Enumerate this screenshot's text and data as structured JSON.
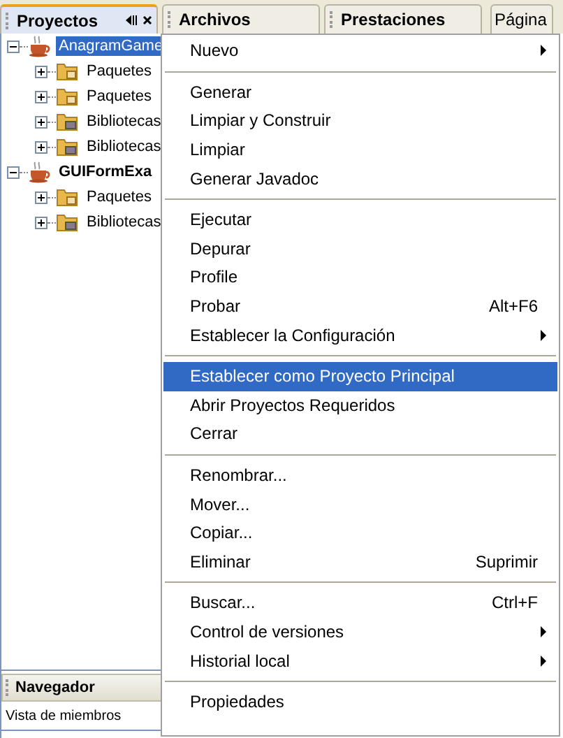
{
  "tabs": [
    {
      "label": "Proyectos",
      "selected": true,
      "closable": true
    },
    {
      "label": "Archivos",
      "selected": false,
      "closable": false
    },
    {
      "label": "Prestaciones",
      "selected": false,
      "closable": false
    },
    {
      "label": "Página",
      "selected": false,
      "closable": false,
      "kind": "editor"
    }
  ],
  "tree": [
    {
      "label": "AnagramGame",
      "kind": "project",
      "selected": true,
      "expanded": true,
      "children": [
        {
          "label": "Paquetes",
          "kind": "package",
          "expanded": false
        },
        {
          "label": "Paquetes",
          "kind": "package",
          "expanded": false
        },
        {
          "label": "Bibliotecas",
          "kind": "library",
          "expanded": false
        },
        {
          "label": "Bibliotecas",
          "kind": "library",
          "expanded": false
        }
      ]
    },
    {
      "label": "GUIFormExa",
      "kind": "project",
      "selected": false,
      "expanded": true,
      "children": [
        {
          "label": "Paquetes",
          "kind": "package",
          "expanded": false
        },
        {
          "label": "Bibliotecas",
          "kind": "library",
          "expanded": false
        }
      ]
    }
  ],
  "navigator": {
    "title": "Navegador",
    "view": "Vista de miembros"
  },
  "menu": [
    {
      "kind": "item",
      "label": "Nuevo",
      "submenu": true,
      "selected": false
    },
    {
      "kind": "separator"
    },
    {
      "kind": "item",
      "label": "Generar",
      "selected": false
    },
    {
      "kind": "item",
      "label": "Limpiar y Construir",
      "selected": false
    },
    {
      "kind": "item",
      "label": "Limpiar",
      "selected": false
    },
    {
      "kind": "item",
      "label": "Generar Javadoc",
      "selected": false
    },
    {
      "kind": "separator"
    },
    {
      "kind": "item",
      "label": "Ejecutar",
      "selected": false
    },
    {
      "kind": "item",
      "label": "Depurar",
      "selected": false
    },
    {
      "kind": "item",
      "label": "Profile",
      "selected": false
    },
    {
      "kind": "item",
      "label": "Probar",
      "shortcut": "Alt+F6",
      "selected": false
    },
    {
      "kind": "item",
      "label": "Establecer la Configuración",
      "submenu": true,
      "selected": false
    },
    {
      "kind": "separator"
    },
    {
      "kind": "item",
      "label": "Establecer como Proyecto Principal",
      "selected": true
    },
    {
      "kind": "item",
      "label": "Abrir Proyectos Requeridos",
      "selected": false
    },
    {
      "kind": "item",
      "label": "Cerrar",
      "selected": false
    },
    {
      "kind": "separator"
    },
    {
      "kind": "item",
      "label": "Renombrar...",
      "selected": false
    },
    {
      "kind": "item",
      "label": "Mover...",
      "selected": false
    },
    {
      "kind": "item",
      "label": "Copiar...",
      "selected": false
    },
    {
      "kind": "item",
      "label": "Eliminar",
      "shortcut": "Suprimir",
      "selected": false
    },
    {
      "kind": "separator"
    },
    {
      "kind": "item",
      "label": "Buscar...",
      "shortcut": "Ctrl+F",
      "selected": false
    },
    {
      "kind": "item",
      "label": "Control de versiones",
      "submenu": true,
      "selected": false
    },
    {
      "kind": "item",
      "label": "Historial local",
      "submenu": true,
      "selected": false
    },
    {
      "kind": "separator"
    },
    {
      "kind": "item",
      "label": "Propiedades",
      "selected": false
    }
  ]
}
